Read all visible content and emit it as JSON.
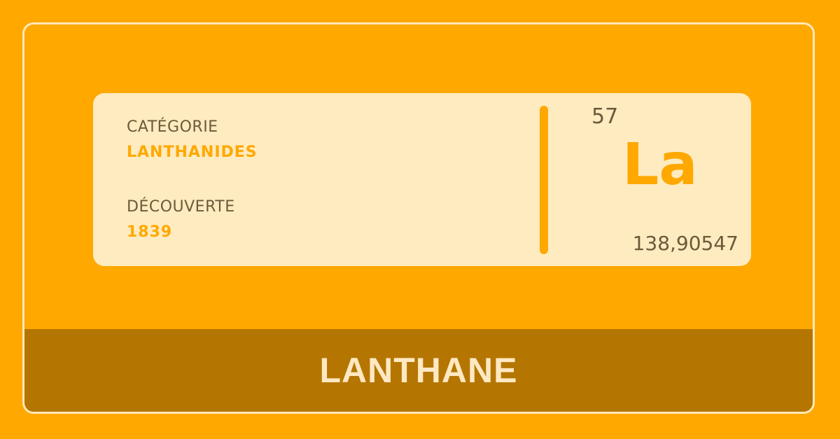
{
  "element": {
    "category_label": "CATÉGORIE",
    "category_value": "LANTHANIDES",
    "discovery_label": "DÉCOUVERTE",
    "discovery_value": "1839",
    "atomic_number": "57",
    "symbol": "La",
    "atomic_mass": "138,90547",
    "name": "LANTHANE"
  },
  "colors": {
    "background": "#FFA800",
    "card": "#FFEBC0",
    "footer": "#B47600",
    "text_dark": "#6B5A3A",
    "accent": "#FFA800"
  }
}
